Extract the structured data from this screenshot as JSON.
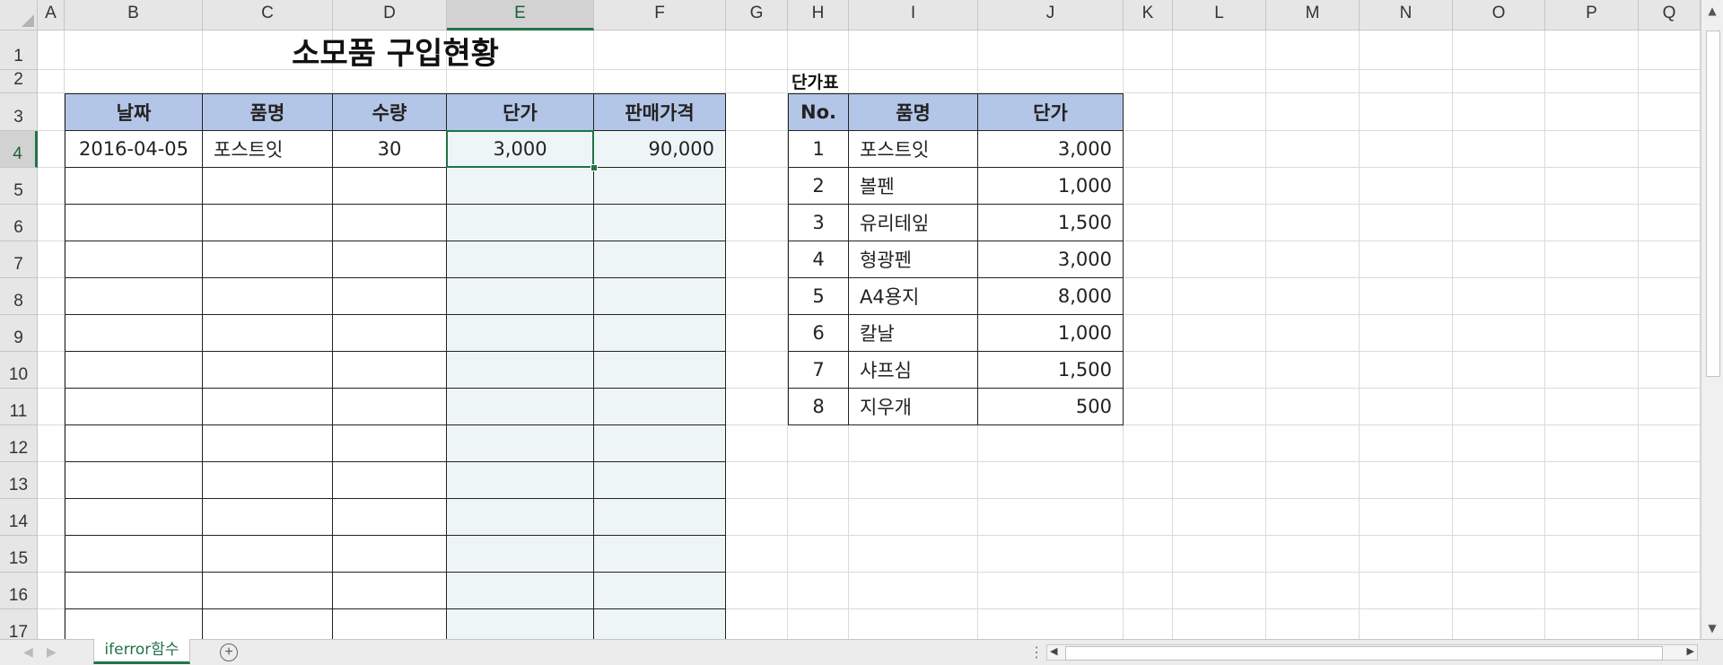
{
  "columns": [
    "A",
    "B",
    "C",
    "D",
    "E",
    "F",
    "G",
    "H",
    "I",
    "J",
    "K",
    "L",
    "M",
    "N",
    "O",
    "P",
    "Q"
  ],
  "rows": [
    "1",
    "2",
    "3",
    "4",
    "5",
    "6",
    "7",
    "8",
    "9",
    "10",
    "11",
    "12",
    "13",
    "14",
    "15",
    "16",
    "17"
  ],
  "selected_cell": "E4",
  "title": "소모품 구입현황",
  "purchase_table": {
    "headers": [
      "날짜",
      "품명",
      "수량",
      "단가",
      "판매가격"
    ],
    "rows": [
      [
        "2016-04-05",
        "포스트잇",
        "30",
        "3,000",
        "90,000"
      ]
    ]
  },
  "price_table": {
    "label": "단가표",
    "headers": [
      "No.",
      "품명",
      "단가"
    ],
    "rows": [
      [
        "1",
        "포스트잇",
        "3,000"
      ],
      [
        "2",
        "볼펜",
        "1,000"
      ],
      [
        "3",
        "유리테잎",
        "1,500"
      ],
      [
        "4",
        "형광펜",
        "3,000"
      ],
      [
        "5",
        "A4용지",
        "8,000"
      ],
      [
        "6",
        "칼날",
        "1,000"
      ],
      [
        "7",
        "샤프심",
        "1,500"
      ],
      [
        "8",
        "지우개",
        "500"
      ]
    ]
  },
  "sheet_tab": "iferror함수",
  "add_sheet_symbol": "+",
  "colors": {
    "header_fill": "#b4c6e7",
    "shaded_fill": "#eef5f7",
    "accent": "#217346"
  }
}
